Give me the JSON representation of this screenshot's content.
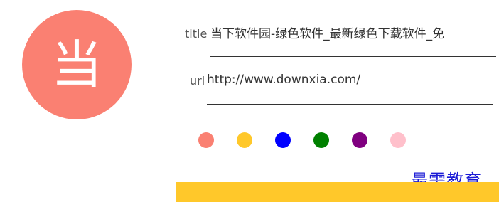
{
  "avatar": {
    "char": "当",
    "color": "#FA8072"
  },
  "form": {
    "title_label": "title",
    "title_value": "当下软件园-绿色软件_最新绿色下载软件_免",
    "url_label": "url",
    "url_value": "http://www.downxia.com/"
  },
  "swatches": [
    {
      "name": "salmon",
      "color": "#FA8072"
    },
    {
      "name": "gold",
      "color": "#FFC82A"
    },
    {
      "name": "blue",
      "color": "#0000FF"
    },
    {
      "name": "green",
      "color": "#008000"
    },
    {
      "name": "purple",
      "color": "#800080"
    },
    {
      "name": "pink",
      "color": "#FFC0CB"
    }
  ],
  "watermark": "最需教育",
  "footer": {
    "color": "#FFC82A"
  }
}
